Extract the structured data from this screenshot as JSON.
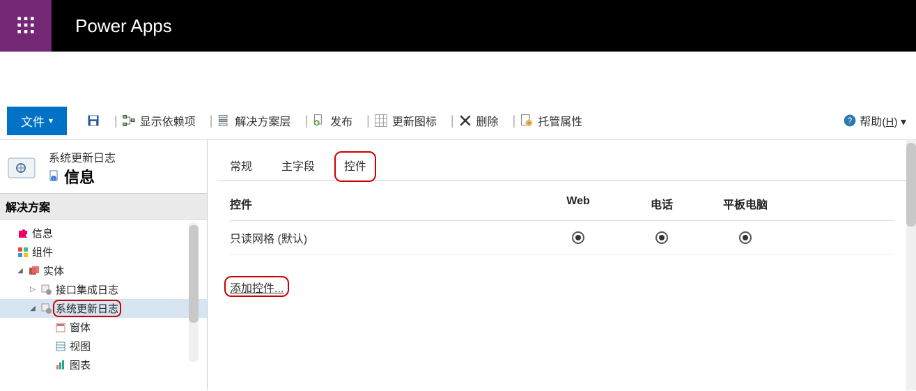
{
  "header": {
    "app_name": "Power Apps"
  },
  "toolbar": {
    "file_label": "文件",
    "show_dep": "显示依赖项",
    "solution_layers": "解决方案层",
    "publish": "发布",
    "update_icon": "更新图标",
    "delete": "删除",
    "managed_props": "托管属性",
    "help": "帮助",
    "help_key": "H"
  },
  "left": {
    "entity_subtitle": "系统更新日志",
    "entity_title": "信息",
    "solution_header": "解决方案",
    "nodes": {
      "info": "信息",
      "components": "组件",
      "entities": "实体",
      "ifacelog": "接口集成日志",
      "sysupdlog": "系统更新日志",
      "forms": "窗体",
      "views": "视图",
      "charts": "图表"
    }
  },
  "right": {
    "tabs": {
      "general": "常规",
      "primary_field": "主字段",
      "controls": "控件"
    },
    "cols": {
      "control": "控件",
      "web": "Web",
      "phone": "电话",
      "tablet": "平板电脑"
    },
    "row1_name": "只读网格 (默认)",
    "add_control": "添加控件..."
  }
}
